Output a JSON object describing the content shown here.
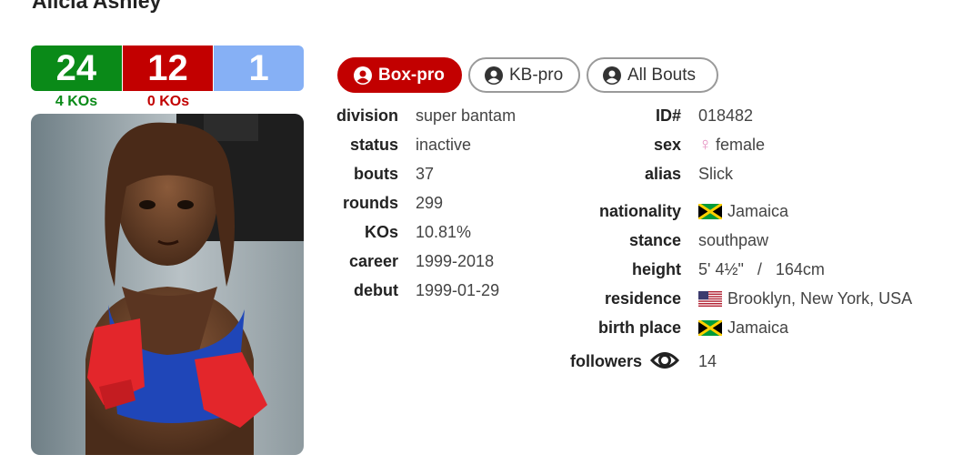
{
  "boxer": {
    "name": "Alicia Ashley"
  },
  "record": {
    "wins": "24",
    "losses": "12",
    "draws": "1",
    "wins_kos": "4 KOs",
    "losses_kos": "0 KOs",
    "colors": {
      "win": "#0a8a18",
      "loss": "#c20000",
      "draw": "#86b0f5"
    }
  },
  "tabs": [
    {
      "label": "Box-pro",
      "active": true
    },
    {
      "label": "KB-pro",
      "active": false
    },
    {
      "label": "All Bouts",
      "active": false
    }
  ],
  "stats_left": [
    {
      "label": "division",
      "value": "super bantam"
    },
    {
      "label": "status",
      "value": "inactive"
    },
    {
      "label": "bouts",
      "value": "37"
    },
    {
      "label": "rounds",
      "value": "299"
    },
    {
      "label": "KOs",
      "value": "10.81%"
    },
    {
      "label": "career",
      "value": "1999-2018"
    },
    {
      "label": "debut",
      "value": "1999-01-29"
    }
  ],
  "stats_right": {
    "id": {
      "label": "ID#",
      "value": "018482"
    },
    "sex": {
      "label": "sex",
      "value": "female",
      "icon": "venus-icon"
    },
    "alias": {
      "label": "alias",
      "value": "Slick"
    },
    "nationality": {
      "label": "nationality",
      "value": "Jamaica",
      "icon": "jamaica-flag-icon"
    },
    "stance": {
      "label": "stance",
      "value": "southpaw"
    },
    "height": {
      "label": "height",
      "value": "5' 4½\"   /   164cm"
    },
    "residence": {
      "label": "residence",
      "value": "Brooklyn, New York, USA",
      "icon": "usa-flag-icon"
    },
    "birth_place": {
      "label": "birth place",
      "value": "Jamaica",
      "icon": "jamaica-flag-icon"
    },
    "followers": {
      "label": "followers",
      "value": "14",
      "icon": "eye-icon"
    }
  }
}
